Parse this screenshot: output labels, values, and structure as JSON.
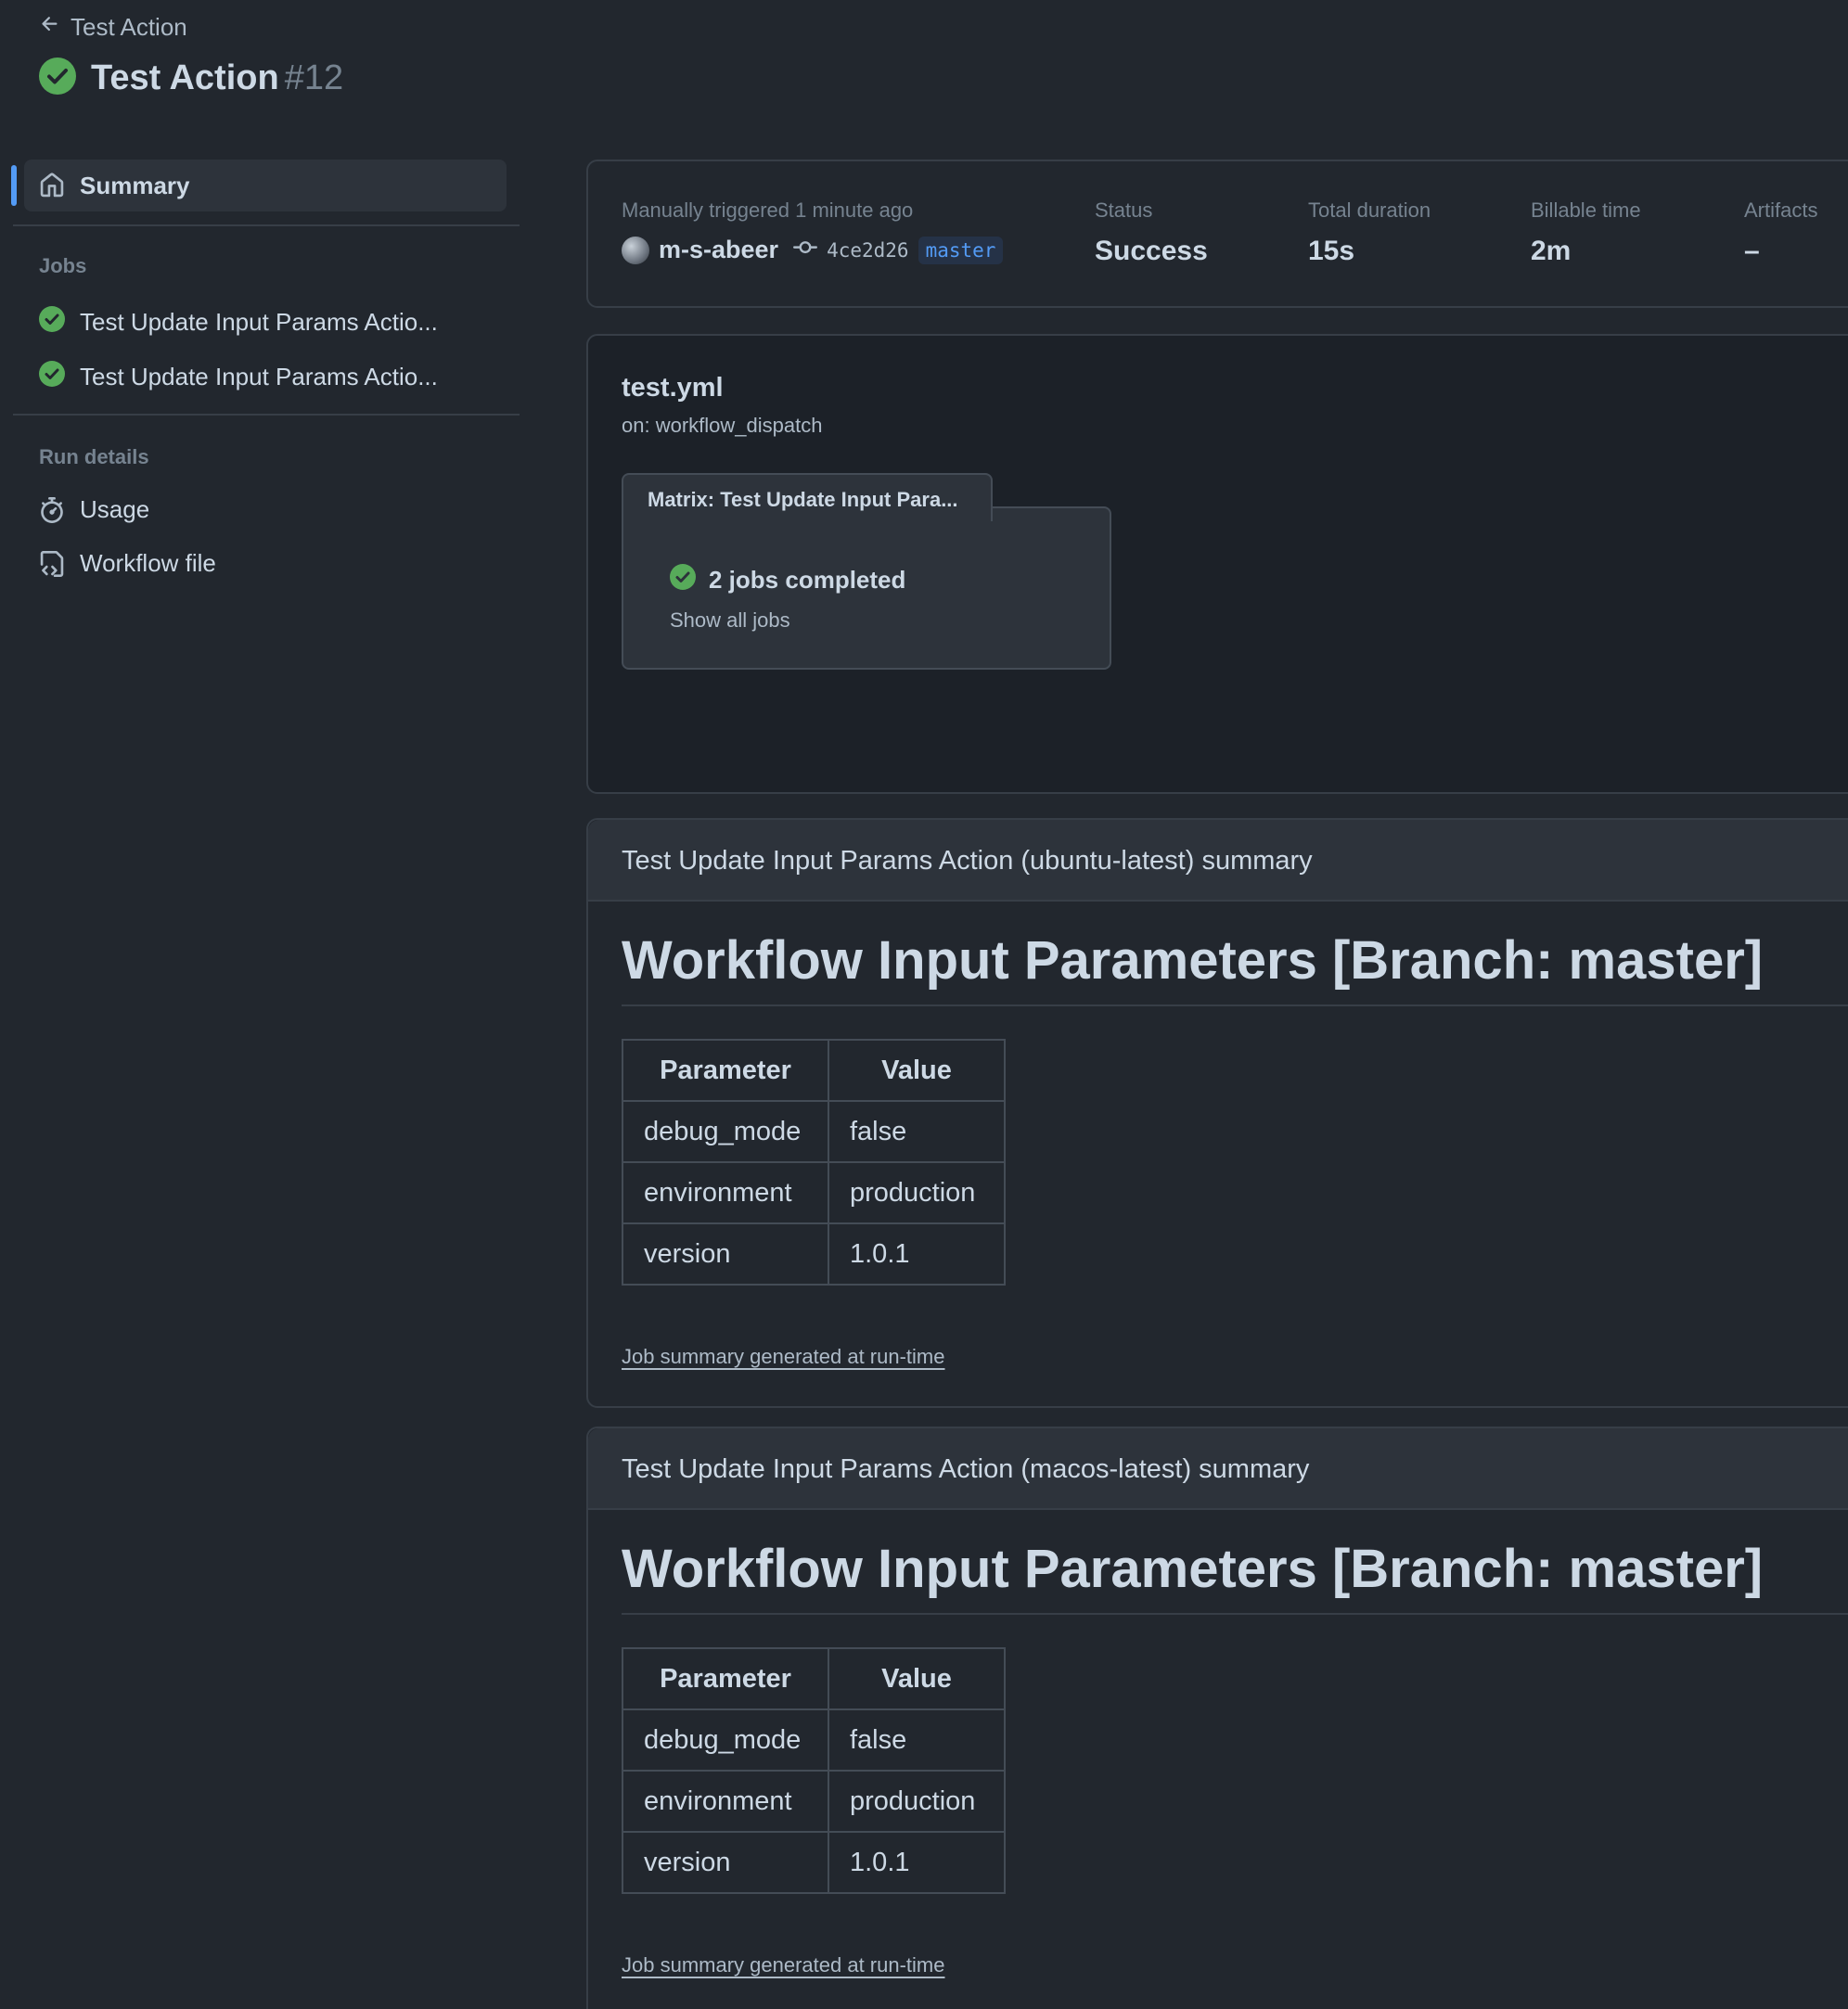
{
  "header": {
    "back_label": "Test Action",
    "title": "Test Action",
    "run_number": "#12"
  },
  "sidebar": {
    "summary_label": "Summary",
    "jobs_heading": "Jobs",
    "jobs": [
      {
        "label": "Test Update Input Params Actio..."
      },
      {
        "label": "Test Update Input Params Actio..."
      }
    ],
    "run_details_heading": "Run details",
    "usage_label": "Usage",
    "workflow_file_label": "Workflow file"
  },
  "stats": {
    "trigger_text": "Manually triggered 1 minute ago",
    "actor": "m-s-abeer",
    "commit_sha": "4ce2d26",
    "branch": "master",
    "status_label": "Status",
    "status_value": "Success",
    "duration_label": "Total duration",
    "duration_value": "15s",
    "billable_label": "Billable time",
    "billable_value": "2m",
    "artifacts_label": "Artifacts",
    "artifacts_value": "–"
  },
  "workflow": {
    "file_name": "test.yml",
    "trigger": "on: workflow_dispatch",
    "matrix_title": "Matrix: Test Update Input Para...",
    "jobs_completed": "2 jobs completed",
    "show_all": "Show all jobs"
  },
  "job_summaries": [
    {
      "title": "Test Update Input Params Action (ubuntu-latest) summary",
      "heading": "Workflow Input Parameters [Branch: master]",
      "columns": [
        "Parameter",
        "Value"
      ],
      "rows": [
        [
          "debug_mode",
          "false"
        ],
        [
          "environment",
          "production"
        ],
        [
          "version",
          "1.0.1"
        ]
      ],
      "footer": "Job summary generated at run-time"
    },
    {
      "title": "Test Update Input Params Action (macos-latest) summary",
      "heading": "Workflow Input Parameters [Branch: master]",
      "columns": [
        "Parameter",
        "Value"
      ],
      "rows": [
        [
          "debug_mode",
          "false"
        ],
        [
          "environment",
          "production"
        ],
        [
          "version",
          "1.0.1"
        ]
      ],
      "footer": "Job summary generated at run-time"
    }
  ],
  "colors": {
    "background": "#22272e",
    "success_green": "#57ab5a",
    "accent_blue": "#539bf5"
  },
  "icons": {
    "back": "arrow-left-icon",
    "success": "check-circle-fill-icon",
    "summary": "home-icon",
    "usage": "stopwatch-icon",
    "workflow_file": "file-code-icon",
    "commit": "git-commit-icon"
  }
}
